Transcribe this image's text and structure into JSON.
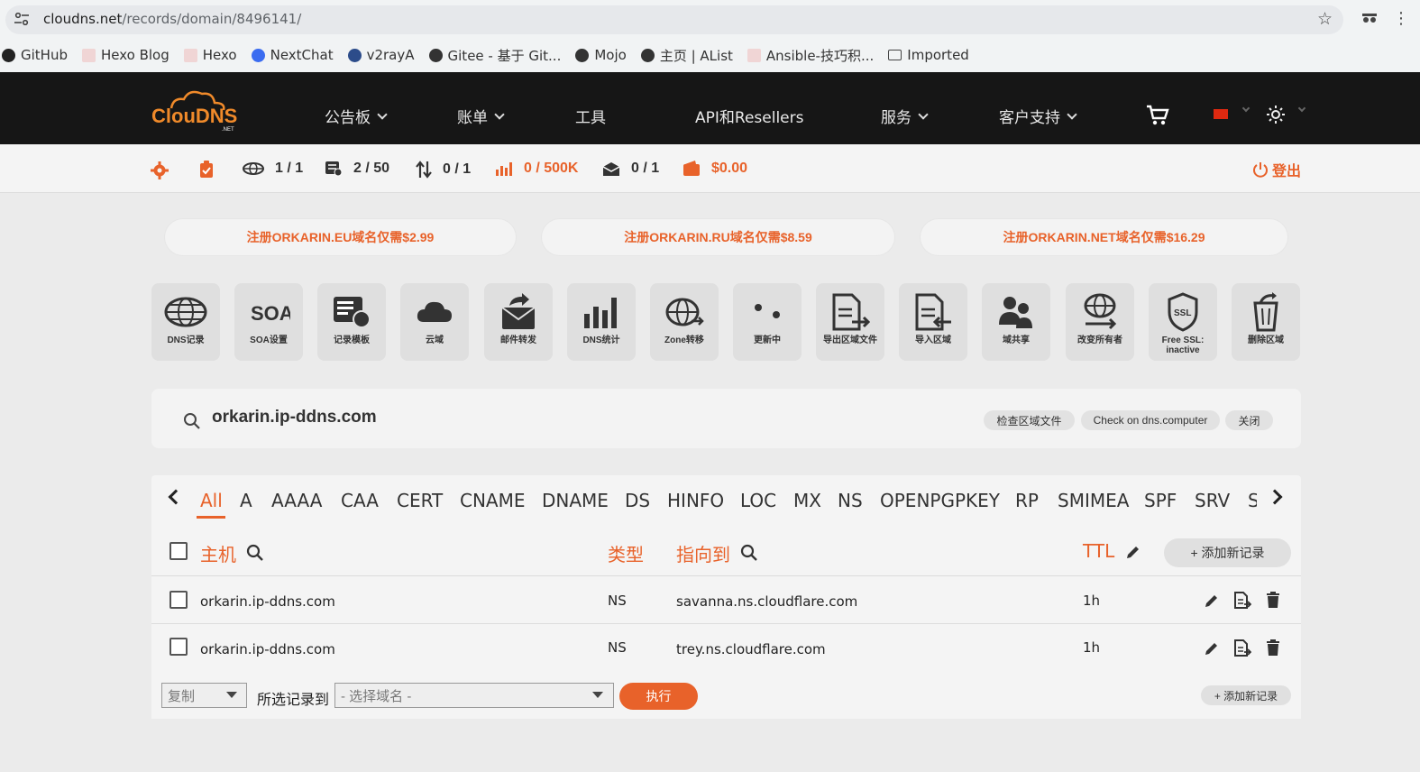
{
  "browser": {
    "url_host": "cloudns.net",
    "url_path": "/records/domain/8496141/",
    "bookmarks": [
      "GitHub",
      "Hexo Blog",
      "Hexo",
      "NextChat",
      "v2rayA",
      "Gitee - 基于 Git...",
      "Mojo",
      "主页 | AList",
      "Ansible-技巧积...",
      "Imported"
    ]
  },
  "nav": {
    "logo_text": "ClouDNS",
    "logo_sub": ".NET",
    "items": [
      "公告板",
      "账单",
      "工具",
      "API和Resellers",
      "服务",
      "客户支持"
    ]
  },
  "stats": {
    "zones": "1 / 1",
    "records": "2 / 50",
    "transfers": "0 / 1",
    "queries": "0 / 500K",
    "mail": "0 / 1",
    "balance": "$0.00",
    "logout": "登出"
  },
  "promos": [
    "注册ORKARIN.EU域名仅需$2.99",
    "注册ORKARIN.RU域名仅需$8.59",
    "注册ORKARIN.NET域名仅需$16.29"
  ],
  "tiles": [
    {
      "label": "DNS记录",
      "icon": "globe-icon"
    },
    {
      "label": "SOA设置",
      "icon": "soa-icon"
    },
    {
      "label": "记录模板",
      "icon": "template-icon"
    },
    {
      "label": "云域",
      "icon": "cloud-icon"
    },
    {
      "label": "邮件转发",
      "icon": "mail-forward-icon"
    },
    {
      "label": "DNS统计",
      "icon": "bar-chart-icon"
    },
    {
      "label": "Zone转移",
      "icon": "zone-transfer-icon"
    },
    {
      "label": "更新中",
      "icon": "updating-icon"
    },
    {
      "label": "导出区域文件",
      "icon": "export-icon"
    },
    {
      "label": "导入区域",
      "icon": "import-icon"
    },
    {
      "label": "域共享",
      "icon": "users-icon"
    },
    {
      "label": "改变所有者",
      "icon": "owner-change-icon"
    },
    {
      "label": "Free SSL:",
      "label2": "inactive",
      "icon": "ssl-shield-icon"
    },
    {
      "label": "删除区域",
      "icon": "trash-icon"
    }
  ],
  "zone": {
    "domain": "orkarin.ip-ddns.com",
    "btn_check": "检查区域文件",
    "btn_dnscomputer": "Check on dns.computer",
    "btn_close": "关闭"
  },
  "tabs": [
    "All",
    "A",
    "AAAA",
    "CAA",
    "CERT",
    "CNAME",
    "DNAME",
    "DS",
    "HINFO",
    "LOC",
    "MX",
    "NS",
    "OPENPGPKEY",
    "RP",
    "SMIMEA",
    "SPF",
    "SRV",
    "S"
  ],
  "table": {
    "col_host": "主机",
    "col_type": "类型",
    "col_points": "指向到",
    "col_ttl": "TTL",
    "add_record": "+ 添加新记录",
    "rows": [
      {
        "host": "orkarin.ip-ddns.com",
        "type": "NS",
        "points_to": "savanna.ns.cloudflare.com",
        "ttl": "1h"
      },
      {
        "host": "orkarin.ip-ddns.com",
        "type": "NS",
        "points_to": "trey.ns.cloudflare.com",
        "ttl": "1h"
      }
    ]
  },
  "footer": {
    "action_value": "复制",
    "selected_to": "所选记录到",
    "domain_placeholder": "- 选择域名 -",
    "execute": "执行",
    "add_record": "+ 添加新记录"
  },
  "colors": {
    "accent": "#e8622a",
    "nav_bg": "#161616"
  }
}
